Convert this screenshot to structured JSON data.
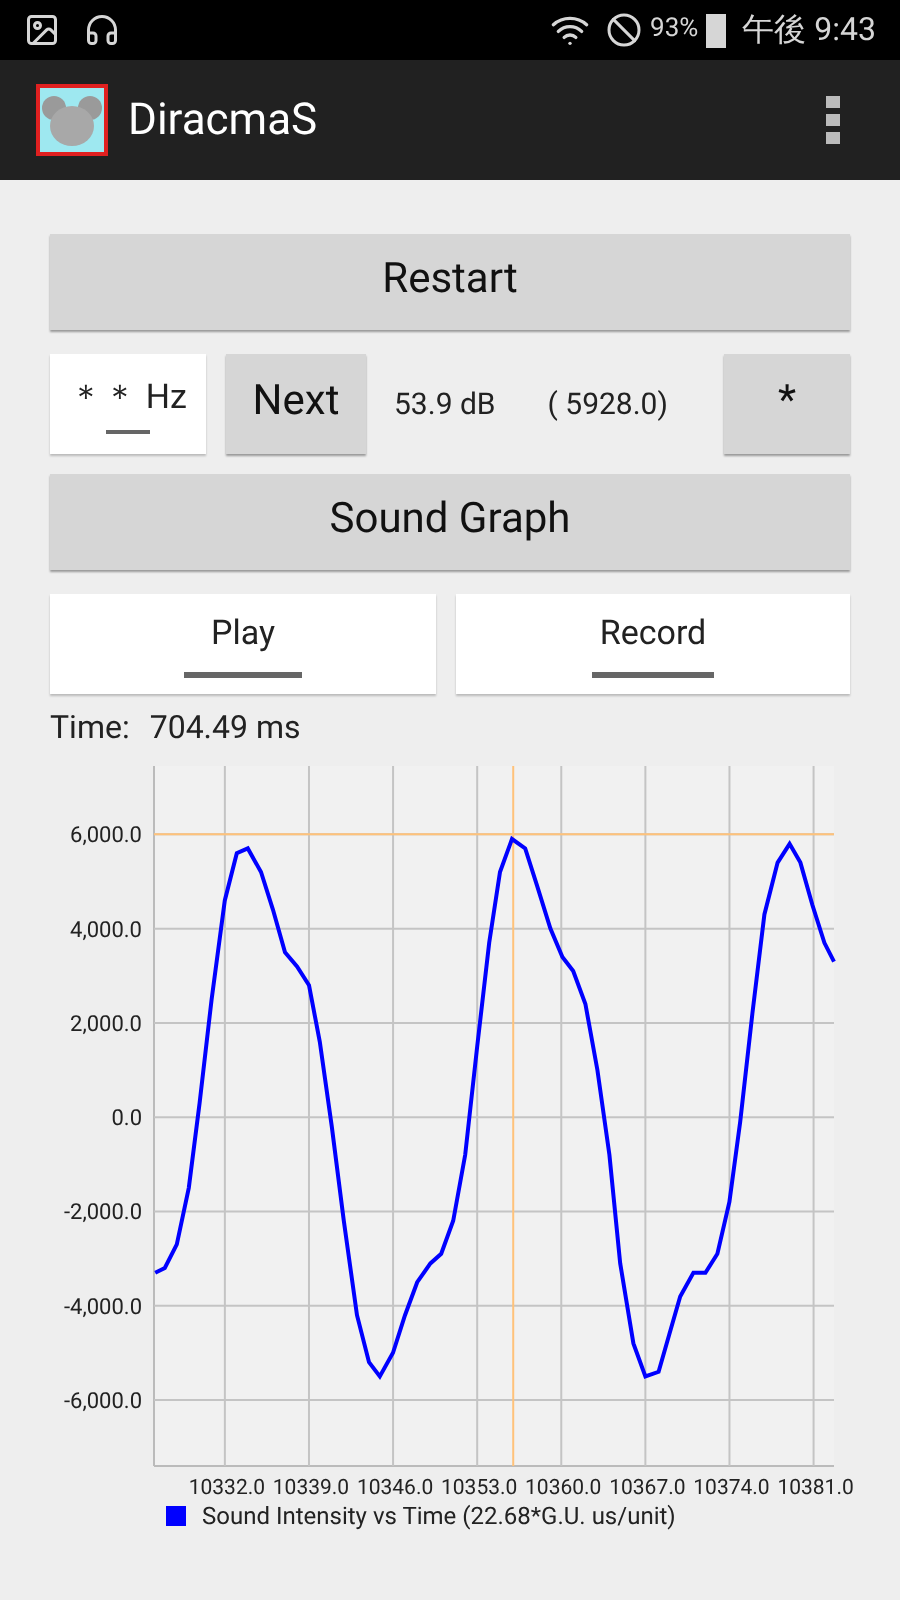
{
  "status_bar": {
    "battery": "93%",
    "time": "午後 9:43"
  },
  "app_bar": {
    "title": "DiracmaS"
  },
  "restart_button": "Restart",
  "tone_row": {
    "frequency_field": "＊＊ Hz",
    "next_button": "Next",
    "level_reading": "53.9 dB",
    "peak_reading": "( 5928.0)",
    "star_button": "*"
  },
  "sound_graph_button": "Sound Graph",
  "play_button": "Play",
  "record_button": "Record",
  "time_label": "Time:",
  "time_value": "704.49 ms",
  "chart_data": {
    "type": "line",
    "x": [
      10326.2,
      10327.0,
      10328.0,
      10329.0,
      10329.9,
      10330.9,
      10332.0,
      10333.0,
      10333.9,
      10335.0,
      10336.0,
      10337.0,
      10338.0,
      10339.0,
      10339.9,
      10340.9,
      10341.9,
      10343.0,
      10344.0,
      10344.9,
      10346.0,
      10347.0,
      10348.0,
      10349.1,
      10350.0,
      10351.0,
      10352.0,
      10353.0,
      10354.0,
      10354.9,
      10355.9,
      10357.0,
      10358.0,
      10359.1,
      10360.1,
      10361.0,
      10362.0,
      10363.0,
      10364.0,
      10364.9,
      10366.0,
      10367.0,
      10368.1,
      10369.0,
      10369.9,
      10371.0,
      10372.0,
      10373.0,
      10374.0,
      10374.9,
      10375.9,
      10376.9,
      10378.0,
      10379.0,
      10379.9,
      10380.9,
      10381.9,
      10382.7
    ],
    "series": [
      {
        "name": "Sound Intensity vs Time (22.68*G.U. us/unit)",
        "color": "#0000ff",
        "values": [
          -3300,
          -3200,
          -2700,
          -1500,
          300,
          2500,
          4600,
          5600,
          5700,
          5200,
          4400,
          3500,
          3200,
          2800,
          1600,
          -200,
          -2200,
          -4200,
          -5200,
          -5500,
          -5000,
          -4200,
          -3500,
          -3100,
          -2900,
          -2200,
          -800,
          1500,
          3700,
          5200,
          5900,
          5700,
          4900,
          4000,
          3400,
          3100,
          2400,
          1000,
          -800,
          -3100,
          -4800,
          -5500,
          -5400,
          -4600,
          -3800,
          -3300,
          -3300,
          -2900,
          -1800,
          -100,
          2200,
          4300,
          5400,
          5800,
          5400,
          4500,
          3700,
          3300
        ]
      }
    ],
    "grid": true,
    "xlim": [
      10326.1,
      10382.7
    ],
    "ylim": [
      -7400,
      7450
    ],
    "xticks": [
      {
        "value": 10332,
        "label": "10332.0"
      },
      {
        "value": 10339,
        "label": "10339.0"
      },
      {
        "value": 10346,
        "label": "10346.0"
      },
      {
        "value": 10353,
        "label": "10353.0"
      },
      {
        "value": 10360,
        "label": "10360.0"
      },
      {
        "value": 10367,
        "label": "10367.0"
      },
      {
        "value": 10374,
        "label": "10374.0"
      },
      {
        "value": 10381,
        "label": "10381.0"
      }
    ],
    "yticks": [
      {
        "value": 6000,
        "label": "6,000.0"
      },
      {
        "value": 4000,
        "label": "4,000.0"
      },
      {
        "value": 2000,
        "label": "2,000.0"
      },
      {
        "value": 0,
        "label": "0.0"
      },
      {
        "value": -2000,
        "label": "-2,000.0"
      },
      {
        "value": -4000,
        "label": "-4,000.0"
      },
      {
        "value": -6000,
        "label": "-6,000.0"
      }
    ],
    "ref_lines": [
      {
        "axis": "x",
        "value": 10356,
        "color": "#ffc27a"
      },
      {
        "axis": "y",
        "value": 6000,
        "color": "#ffc27a"
      }
    ]
  }
}
